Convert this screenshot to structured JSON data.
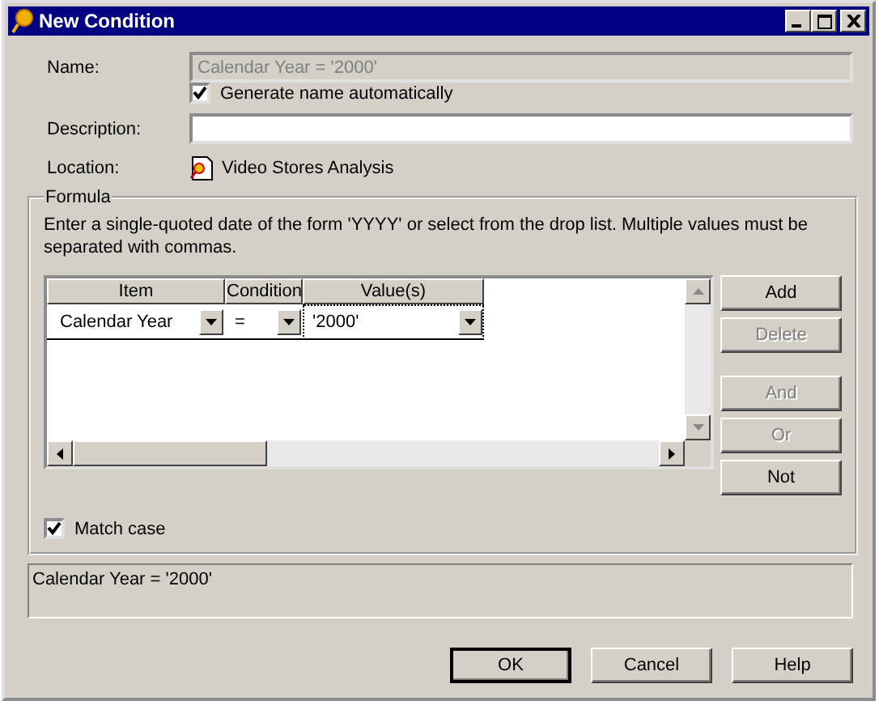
{
  "window": {
    "title": "New Condition"
  },
  "name": {
    "label": "Name:",
    "value": "Calendar Year = '2000'",
    "disabled": true
  },
  "generate_name": {
    "label": "Generate name automatically",
    "checked": true
  },
  "description": {
    "label": "Description:"
  },
  "location": {
    "label": "Location:",
    "value": "Video Stores Analysis"
  },
  "formula": {
    "title": "Formula",
    "instructions": "Enter a single-quoted date of the form 'YYYY' or select from the drop list. Multiple values must be separated with commas.",
    "columns": [
      "Item",
      "Condition",
      "Value(s)"
    ],
    "rows": [
      {
        "item": "Calendar Year",
        "condition": "=",
        "value": "'2000'"
      }
    ],
    "buttons": [
      {
        "label": "Add",
        "disabled": false
      },
      {
        "label": "Delete",
        "disabled": true
      },
      {
        "label": "And",
        "disabled": true
      },
      {
        "label": "Or",
        "disabled": true
      },
      {
        "label": "Not",
        "disabled": false
      }
    ],
    "match_case": {
      "label": "Match case",
      "checked": true
    }
  },
  "summary": "Calendar Year = '2000'",
  "buttons": [
    {
      "label": "OK",
      "default": true
    },
    {
      "label": "Cancel",
      "default": false
    },
    {
      "label": "Help",
      "default": false
    }
  ]
}
